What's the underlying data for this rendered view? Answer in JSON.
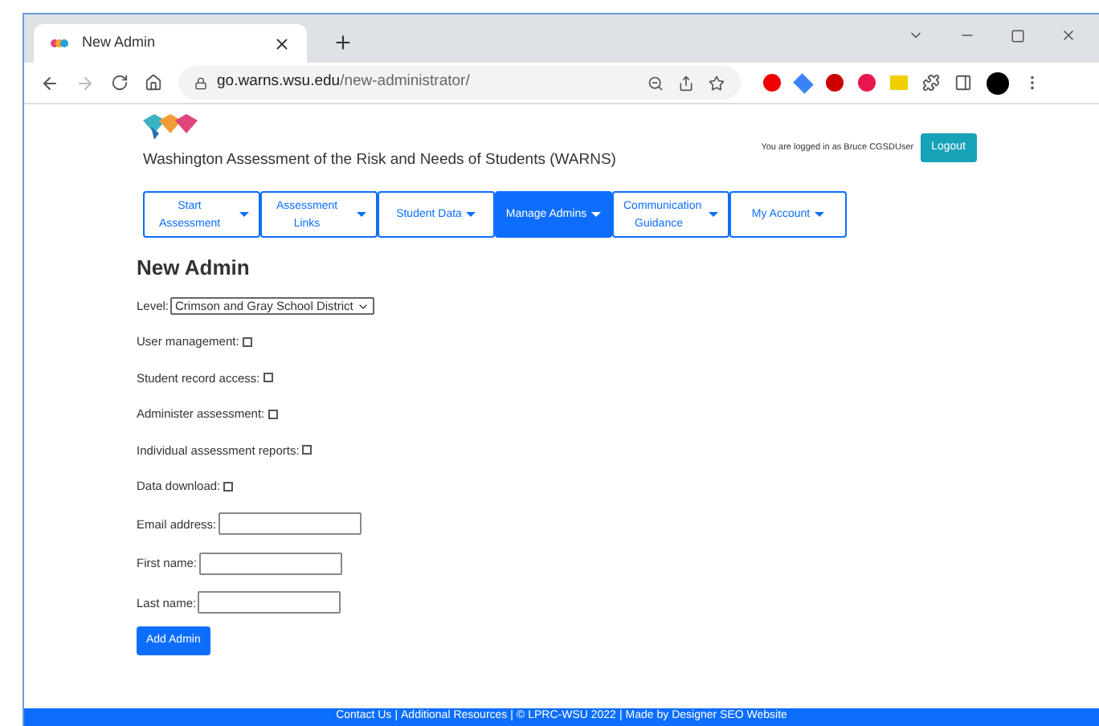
{
  "browser": {
    "tab_title": "New Admin",
    "url_host": "go.warns.wsu.edu",
    "url_path": "/new-administrator/"
  },
  "header": {
    "site_title": "Washington Assessment of the Risk and Needs of Students (WARNS)",
    "login_text": "You are logged in as Bruce CGSDUser",
    "logout": "Logout"
  },
  "nav": [
    {
      "label": "Start Assessment",
      "selected": false,
      "two_line": true
    },
    {
      "label": "Assessment Links",
      "selected": false,
      "two_line": true
    },
    {
      "label": "Student Data",
      "selected": false,
      "two_line": false
    },
    {
      "label": "Manage Admins",
      "selected": true,
      "two_line": false
    },
    {
      "label": "Communication Guidance",
      "selected": false,
      "two_line": true
    },
    {
      "label": "My Account",
      "selected": false,
      "two_line": false
    }
  ],
  "heading": "New Admin",
  "level": {
    "label": "Level:",
    "value": "Crimson and Gray School District"
  },
  "fields": [
    {
      "kind": "checkbox",
      "label": "User management:",
      "checked": false
    },
    {
      "kind": "checkbox",
      "label": "Student record access:",
      "checked": false
    },
    {
      "kind": "checkbox",
      "label": "Administer assessment:",
      "checked": false
    },
    {
      "kind": "checkbox",
      "label": "Individual assessment reports:",
      "checked": false
    },
    {
      "kind": "checkbox",
      "label": "Data download:",
      "checked": false
    },
    {
      "kind": "text",
      "label": "Email address:"
    },
    {
      "kind": "text",
      "label": "First name:"
    },
    {
      "kind": "text",
      "label": "Last name:"
    }
  ],
  "submit": "Add Admin",
  "footer": [
    "Contact Us",
    "|",
    "Additional Resources",
    "|",
    "© LPRC-WSU 2022",
    "|",
    "Made by Designer SEO Website"
  ]
}
